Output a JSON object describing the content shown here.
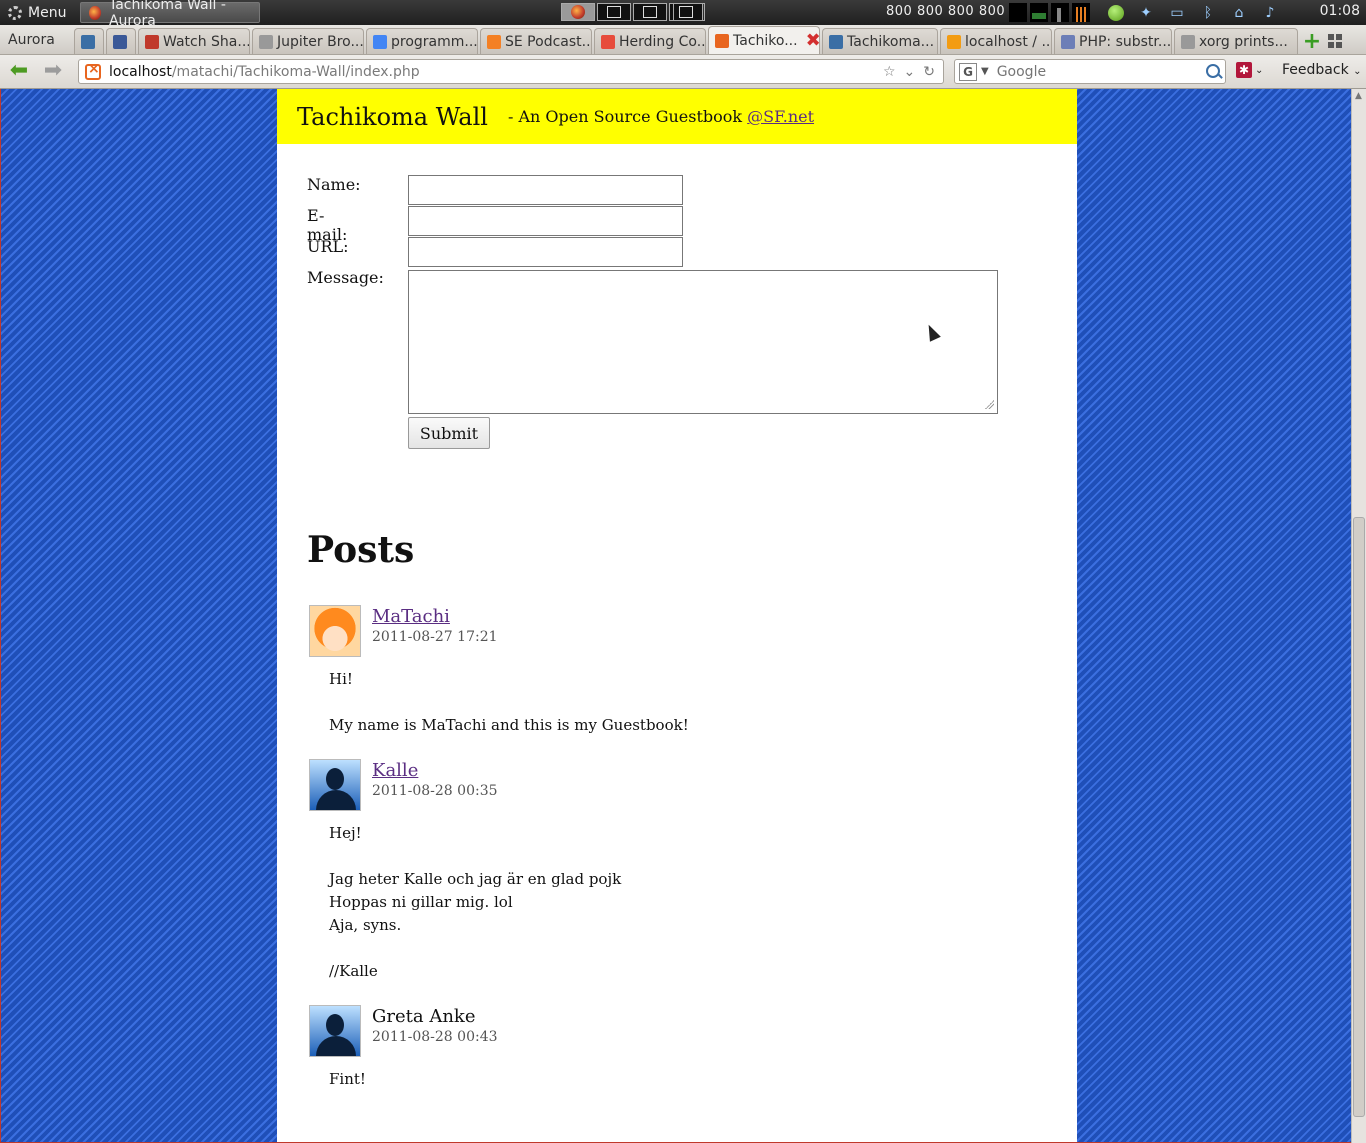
{
  "panel": {
    "menu_label": "Menu",
    "task_title": "Tachikoma Wall - Aurora",
    "cpu_freqs": "800  800  800  800",
    "clock": "01:08"
  },
  "browser": {
    "app_name": "Aurora",
    "tabs": [
      {
        "label": "",
        "icon": "rss-icon",
        "color": "#3a6ea5"
      },
      {
        "label": "",
        "icon": "facebook-icon",
        "color": "#3b5998"
      },
      {
        "label": "Watch Sha...",
        "icon": "film-icon",
        "color": "#c0392b"
      },
      {
        "label": "Jupiter Bro...",
        "icon": "page-icon",
        "color": "#999999"
      },
      {
        "label": "programm...",
        "icon": "google-icon",
        "color": "#4285f4"
      },
      {
        "label": "SE Podcast...",
        "icon": "stack-icon",
        "color": "#f48024"
      },
      {
        "label": "Herding Co...",
        "icon": "flame-icon",
        "color": "#e74c3c"
      },
      {
        "label": "Tachiko...",
        "icon": "xampp-icon",
        "color": "#e8651f",
        "active": true
      },
      {
        "label": "Tachikoma...",
        "icon": "sourceforge-icon",
        "color": "#3a6ea5"
      },
      {
        "label": "localhost / ...",
        "icon": "phpmyadmin-icon",
        "color": "#f39c12"
      },
      {
        "label": "PHP: substr...",
        "icon": "php-icon",
        "color": "#6c7eb7"
      },
      {
        "label": "xorg prints...",
        "icon": "page-icon",
        "color": "#999999"
      }
    ],
    "url_host": "localhost",
    "url_path": "/matachi/Tachikoma-Wall/index.php",
    "search_placeholder": "Google",
    "feedback_label": "Feedback"
  },
  "page": {
    "title": "Tachikoma Wall",
    "tagline_prefix": "- An Open Source Guestbook ",
    "tagline_link": "@SF.net",
    "form": {
      "name_label": "Name:",
      "email_label": "E-mail:",
      "url_label": "URL:",
      "message_label": "Message:",
      "name_value": "",
      "email_value": "",
      "url_value": "",
      "submit_label": "Submit"
    },
    "posts_heading": "Posts",
    "posts": [
      {
        "author": "MaTachi",
        "date": "2011-08-27 17:21",
        "linked": true,
        "avatar": "anime",
        "body": "Hi!\n\nMy name is MaTachi and this is my Guestbook!"
      },
      {
        "author": "Kalle",
        "date": "2011-08-28 00:35",
        "linked": true,
        "avatar": "silhouette",
        "body": "Hej!\n\nJag heter Kalle och jag är en glad pojk\nHoppas ni gillar mig. lol\nAja, syns.\n\n//Kalle"
      },
      {
        "author": "Greta Anke",
        "date": "2011-08-28 00:43",
        "linked": false,
        "avatar": "silhouette",
        "body": "Fint!"
      }
    ]
  },
  "colors": {
    "header_bg": "#ffff00",
    "link": "#5a2d82",
    "page_bg_stripe_dark": "#1f4fb8",
    "page_bg_stripe_light": "#3b6fe0"
  }
}
